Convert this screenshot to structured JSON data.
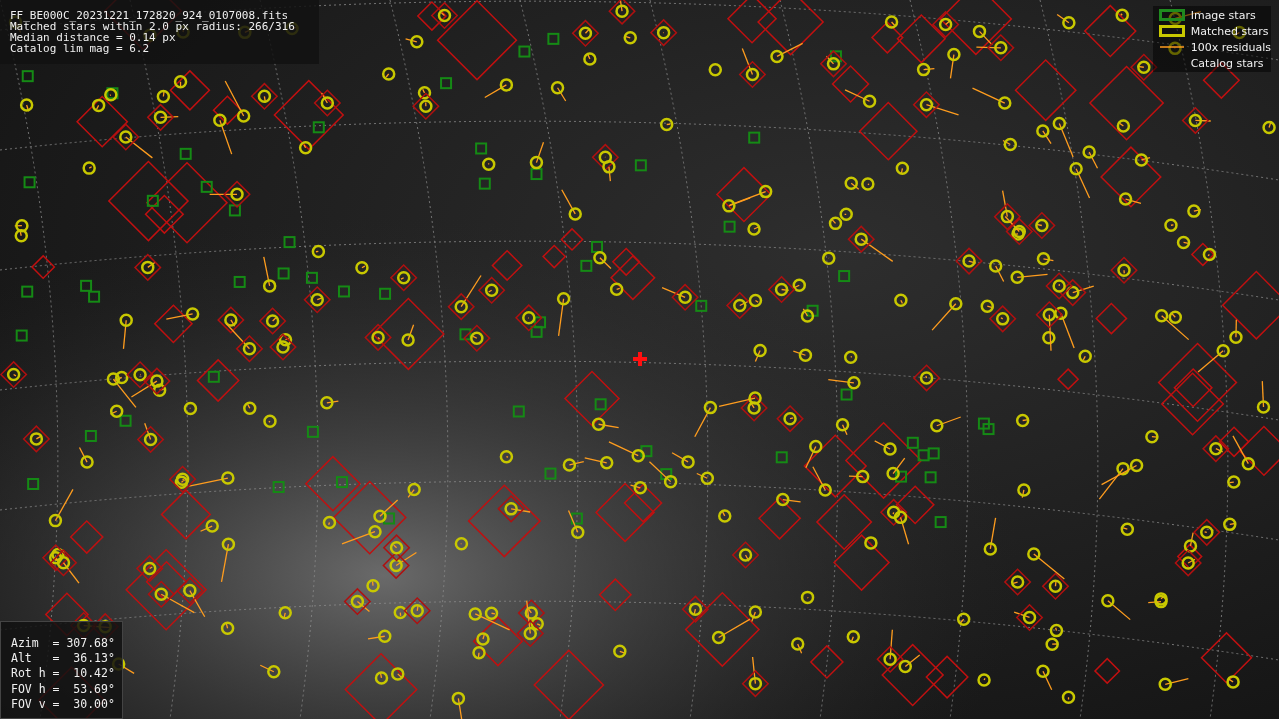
{
  "header_info": {
    "lines": [
      "FF_BE000C_20231221_172820_924_0107008.fits",
      "Matched stars within 2.0 px radius: 266/316",
      "Median distance = 0.14 px",
      "Catalog lim mag = 6.2"
    ]
  },
  "legend": {
    "items": [
      {
        "kind": "image",
        "label": "Image stars"
      },
      {
        "kind": "matched",
        "label": "Matched stars"
      },
      {
        "kind": "residual",
        "label": "100x residuals"
      },
      {
        "kind": "catalog",
        "label": "Catalog stars"
      }
    ]
  },
  "pointing_info": {
    "lines": [
      "Azim  = 307.68°",
      "Alt   =  36.13°",
      "Rot h =  10.42°",
      "FOV h =  53.69°",
      "FOV v =  30.00°"
    ]
  }
}
